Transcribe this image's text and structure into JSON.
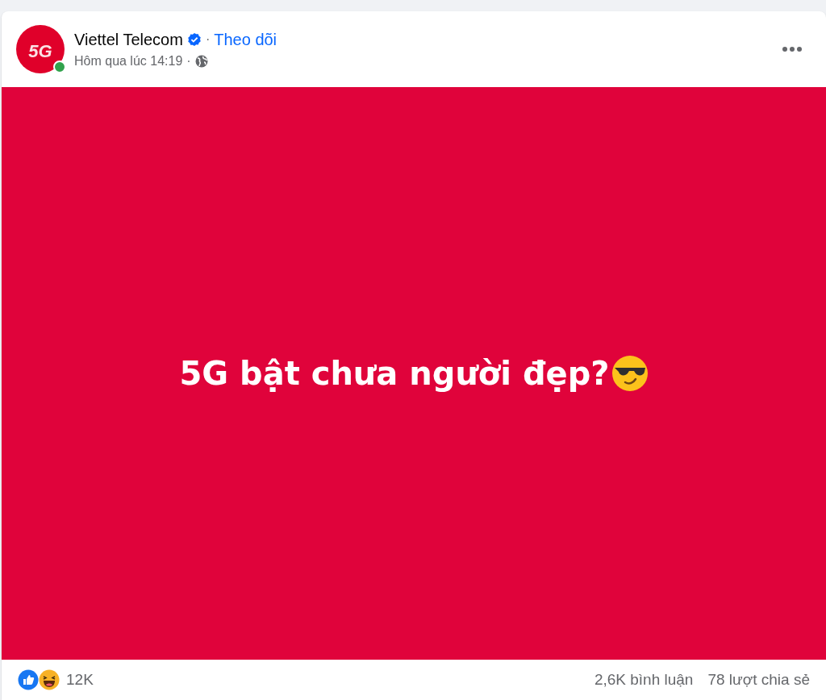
{
  "post": {
    "author": "Viettel Telecom",
    "verified": true,
    "separator": "·",
    "follow": "Theo dõi",
    "time": "Hôm qua lúc 14:19",
    "time_separator": "·",
    "avatar": {
      "text": "5G",
      "online": true
    }
  },
  "image": {
    "text": "5G bật chưa người đẹp?"
  },
  "footer": {
    "reactions_count": "12K",
    "comments": "2,6K bình luận",
    "shares": "78 lượt chia sẻ"
  }
}
